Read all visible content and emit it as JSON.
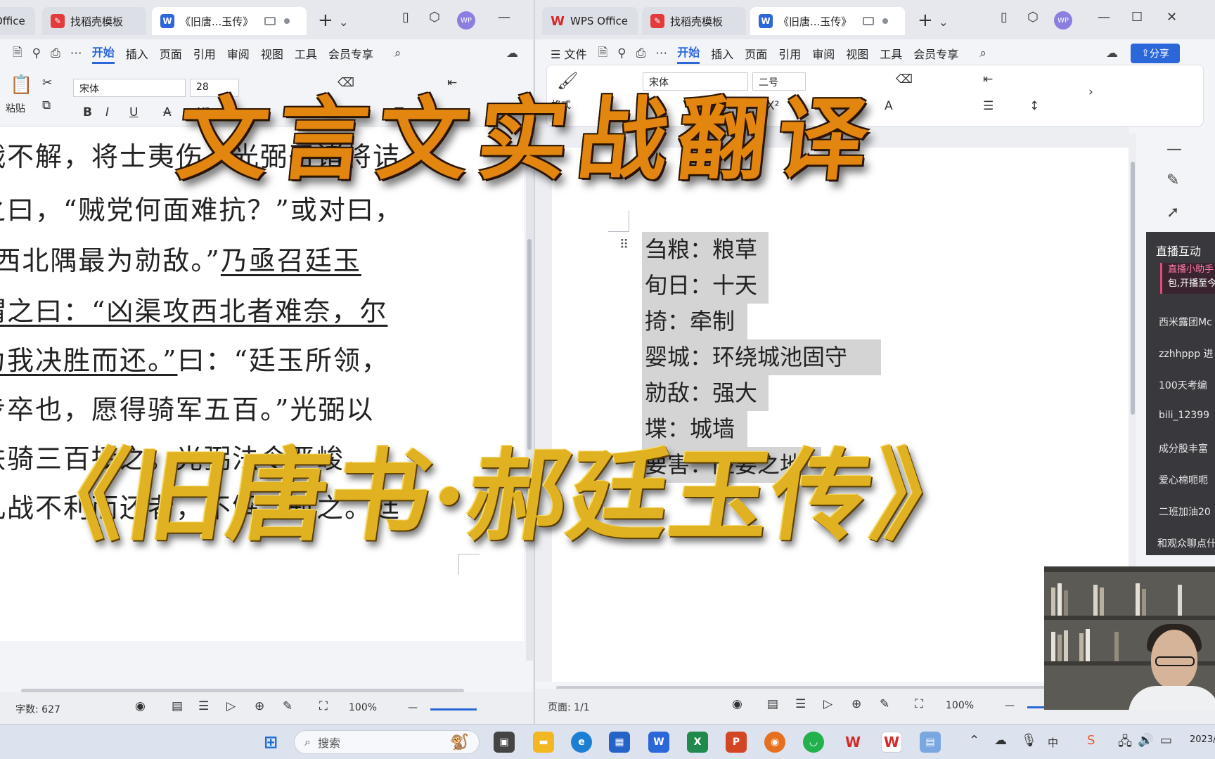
{
  "left_window": {
    "tabs": [
      {
        "label": "Office"
      },
      {
        "label": "找稻壳模板"
      },
      {
        "label": "《旧唐...玉传》"
      }
    ],
    "menu": [
      "开始",
      "插入",
      "页面",
      "引用",
      "审阅",
      "视图",
      "工具",
      "会员专享"
    ],
    "font_name": "宋体",
    "font_size": "28",
    "paste_label": "粘贴",
    "lines": [
      {
        "text": "战不解，将士夷伤。光弼召诸将诘"
      },
      {
        "text": "之曰，“贼党何面难抗？”或对曰，"
      },
      {
        "text": "“西北隅最为勍敌。”",
        "u": "乃亟召廷玉"
      },
      {
        "u": "谓之曰：“凶渠攻西北者难奈，尔"
      },
      {
        "u": "为我决胜而还。”",
        "text": "曰：“廷玉所领，"
      },
      {
        "text": "步卒也，愿得骑军五百。”光弼以"
      },
      {
        "text": "铁骑三百授之。光弼法令严峻，"
      },
      {
        "text": "凡战不利而还者，不解，斩之。廷"
      }
    ],
    "status": {
      "word_count": "字数: 627",
      "zoom": "100%"
    }
  },
  "right_window": {
    "tabs": [
      {
        "label": "WPS Office"
      },
      {
        "label": "找稻壳模板"
      },
      {
        "label": "《旧唐...玉传》"
      }
    ],
    "menu_file": "文件",
    "menu": [
      "开始",
      "插入",
      "页面",
      "引用",
      "审阅",
      "视图",
      "工具",
      "会员专享"
    ],
    "share_label": "分享",
    "font_name": "宋体",
    "font_size": "二号",
    "format_label": "格式",
    "glossary": [
      "刍粮：粮草",
      "旬日：十天",
      "掎：牵制",
      "婴城：环绕城池固守",
      "勍敌：强大",
      "堞：城墙",
      "要害：险要之地"
    ],
    "status": {
      "page": "页面: 1/1",
      "zoom": "100%"
    }
  },
  "overlay": {
    "title_top": "文言文实战翻译",
    "title_bottom": "《旧唐书·郝廷玉传》"
  },
  "live_panel": {
    "title": "直播互动",
    "notice_line1": "直播小助手",
    "notice_line2": "包,开播至今",
    "messages": [
      "西米露团Mc",
      "zzhhppp 进",
      "100天考编",
      "bili_12399",
      "成分股丰富",
      "爱心棉呃呃",
      "二班加油20",
      "和观众聊点什"
    ]
  },
  "taskbar": {
    "search_placeholder": "搜索",
    "clock": "2023/"
  },
  "colors": {
    "accent": "#2b67d9",
    "title_orange": "#e2860f",
    "title_gold": "#e0b120",
    "highlight_gray": "#d4d4d4"
  }
}
